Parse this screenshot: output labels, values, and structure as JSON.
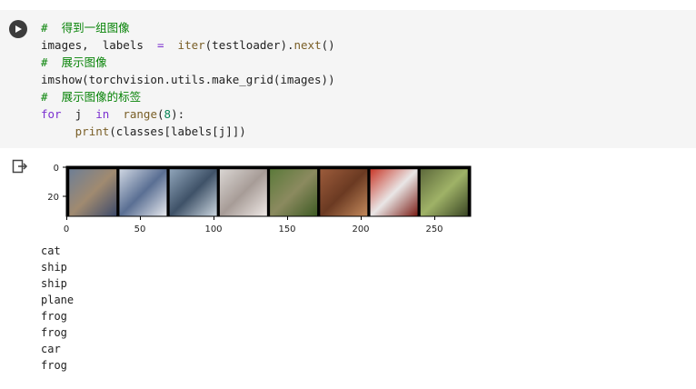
{
  "code_cell": {
    "line1": "#  得到一组图像",
    "line2_var": "images,  labels",
    "line2_eq": "=",
    "line2_fn": "iter",
    "line2_mid": "(testloader).",
    "line2_fn2": "next",
    "line2_end": "()",
    "line3": "#  展示图像",
    "line4": "imshow(torchvision.utils.make_grid(images))",
    "line5": "#  展示图像的标签",
    "line6_for": "for",
    "line6_j": "j",
    "line6_in": "in",
    "line6_range": "range",
    "line6_open": "(",
    "line6_num": "8",
    "line6_close": "):",
    "line7_indent": "     ",
    "line7_print": "print",
    "line7_args": "(classes[labels[j]])"
  },
  "plot": {
    "y_ticks": [
      "0",
      "20"
    ],
    "x_ticks": [
      "0",
      "50",
      "100",
      "150",
      "200",
      "250"
    ]
  },
  "chart_data": {
    "type": "image",
    "xlim": [
      0,
      274
    ],
    "ylim": [
      34,
      0
    ],
    "x_ticks": [
      0,
      50,
      100,
      150,
      200,
      250
    ],
    "y_ticks": [
      0,
      20
    ],
    "tiles": [
      {
        "label": "cat",
        "colors": [
          "#6f7f95",
          "#a08a70",
          "#3d4a6b"
        ]
      },
      {
        "label": "ship",
        "colors": [
          "#cfd6e2",
          "#5a6f93",
          "#e8eaef"
        ]
      },
      {
        "label": "ship",
        "colors": [
          "#8fa4b9",
          "#3f5268",
          "#cbd6df"
        ]
      },
      {
        "label": "plane",
        "colors": [
          "#d9d5d2",
          "#a79c97",
          "#efe9e6"
        ]
      },
      {
        "label": "frog",
        "colors": [
          "#5c7a3b",
          "#8b8a5f",
          "#3e5b24"
        ]
      },
      {
        "label": "frog",
        "colors": [
          "#9b5b3b",
          "#6b3a22",
          "#c48a5c"
        ]
      },
      {
        "label": "car",
        "colors": [
          "#c93a2b",
          "#e9e6e6",
          "#7b1d15"
        ]
      },
      {
        "label": "frog",
        "colors": [
          "#5e6a3c",
          "#9fb267",
          "#3a4624"
        ]
      }
    ]
  },
  "output": {
    "lines": [
      "cat",
      "ship",
      "ship",
      "plane",
      "frog",
      "frog",
      "car",
      "frog"
    ]
  }
}
